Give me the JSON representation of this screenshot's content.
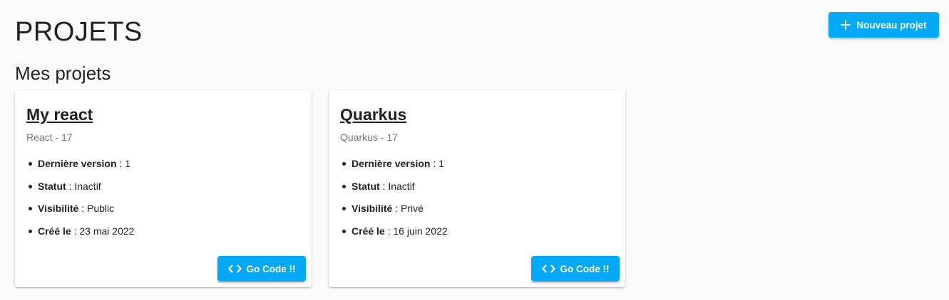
{
  "header": {
    "title": "PROJETS",
    "new_project_label": "Nouveau projet",
    "new_project_icon": "plus-icon"
  },
  "section": {
    "title": "Mes projets"
  },
  "projects": [
    {
      "name": "My react",
      "subtitle": "React - 17",
      "props": [
        {
          "key": "Dernière version",
          "value": " : 1"
        },
        {
          "key": "Statut",
          "value": " : Inactif"
        },
        {
          "key": "Visibilité",
          "value": " : Public"
        },
        {
          "key": "Créé le",
          "value": " : 23 mai 2022"
        }
      ],
      "button_label": "Go Code !!",
      "button_icon": "code-icon"
    },
    {
      "name": "Quarkus",
      "subtitle": "Quarkus - 17",
      "props": [
        {
          "key": "Dernière version",
          "value": " : 1"
        },
        {
          "key": "Statut",
          "value": " : Inactif"
        },
        {
          "key": "Visibilité",
          "value": " : Privé"
        },
        {
          "key": "Créé le",
          "value": " : 16 juin 2022"
        }
      ],
      "button_label": "Go Code !!",
      "button_icon": "code-icon"
    }
  ],
  "colors": {
    "accent": "#03a9f4",
    "background": "#fafafa",
    "card": "#ffffff",
    "text": "#212121",
    "muted": "#757575"
  }
}
